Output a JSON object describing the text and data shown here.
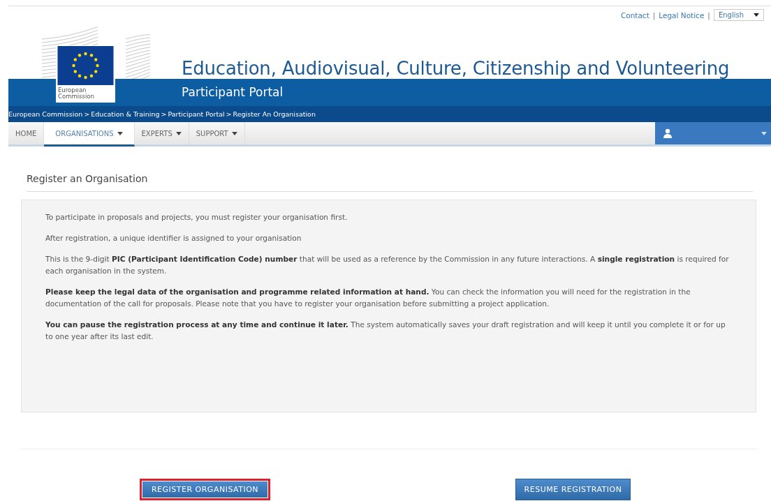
{
  "top_links": [
    {
      "label": "Contact",
      "separator": "|"
    },
    {
      "label": "Legal Notice",
      "separator": "|"
    }
  ],
  "language": {
    "value": "English"
  },
  "logo": {
    "caption": "European Commission"
  },
  "site_title": "Education, Audiovisual, Culture, Citizenship and Volunteering",
  "portal_name": "Participant Portal",
  "breadcrumb": [
    {
      "label": "European Commission"
    },
    {
      "separator": ">",
      "label": "Education & Training"
    },
    {
      "separator": ">",
      "label": "Participant Portal"
    },
    {
      "separator": ">",
      "label": "Register An Organisation"
    }
  ],
  "nav_tabs": [
    {
      "label": "HOME",
      "dropdown": false,
      "selected": false
    },
    {
      "label": "ORGANISATIONS",
      "dropdown": true,
      "selected": true
    },
    {
      "label": "EXPERTS",
      "dropdown": true,
      "selected": false
    },
    {
      "label": "SUPPORT",
      "dropdown": true,
      "selected": false
    }
  ],
  "page_heading": "Register an Organisation",
  "paragraphs": [
    "To participate in proposals and projects, you must register your organisation first.",
    "After registration, a unique identifier is assigned to your organisation",
    "This is the 9-digit **PIC (Participant Identification Code) number** that will be used as a reference by the Commission in any future interactions. A **single registration** is required for each organisation in the system.",
    "**Please keep the legal data of the organisation and programme related information at hand.** You can check the information you will need for the registration in the documentation of the call for proposals. Please note that you have to register your organisation before submitting a project application.",
    "**You can pause the registration process at any time and continue it later.** The system automatically saves your draft registration and will keep it until you complete it or for up to one year after its last edit."
  ],
  "buttons": [
    {
      "label": "REGISTER ORGANISATION",
      "highlighted": true
    },
    {
      "label": "RESUME REGISTRATION",
      "highlighted": false
    }
  ]
}
